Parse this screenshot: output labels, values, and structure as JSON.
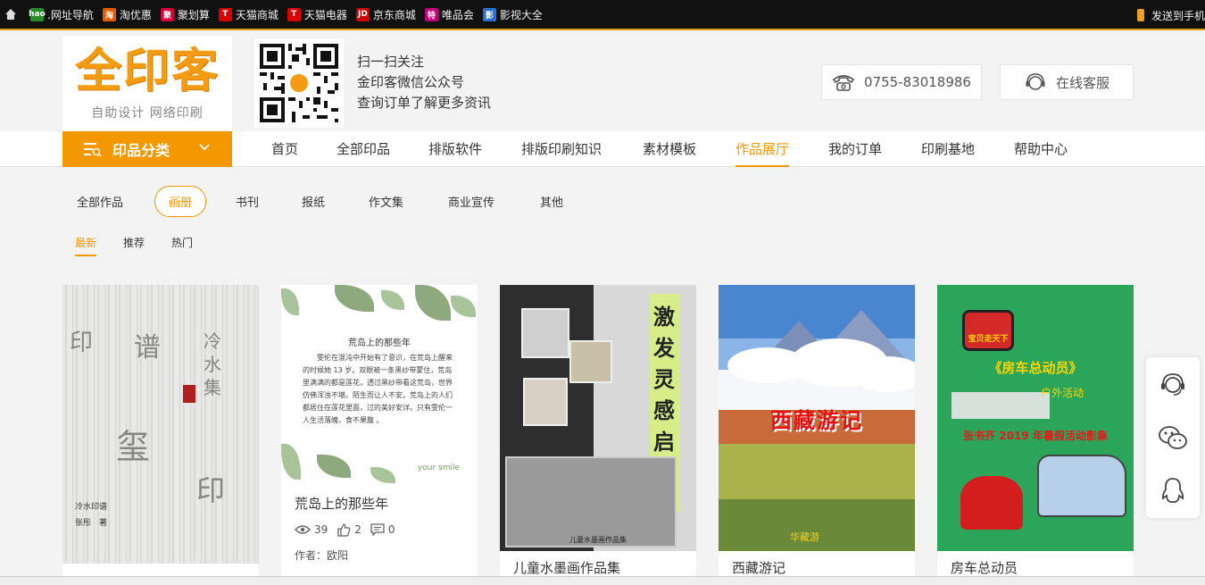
{
  "bookmarks": {
    "items": [
      {
        "icon": "hao",
        "color": "#2b8a2b",
        "label": ".网址导航"
      },
      {
        "icon": "淘",
        "color": "#e85a00",
        "label": "淘优惠"
      },
      {
        "icon": "聚",
        "color": "#d6003a",
        "label": "聚划算"
      },
      {
        "icon": "T",
        "color": "#d80000",
        "label": "天猫商城"
      },
      {
        "icon": "T",
        "color": "#d80000",
        "label": "天猫电器"
      },
      {
        "icon": "JD",
        "color": "#cc0000",
        "label": "京东商城"
      },
      {
        "icon": "特",
        "color": "#c2007a",
        "label": "唯品会"
      },
      {
        "icon": "影",
        "color": "#2b6fd0",
        "label": "影视大全"
      }
    ],
    "send_to_phone": "发送到手机"
  },
  "header": {
    "logo": "全印客",
    "logo_sub": "自助设计  网络印刷",
    "qr_lines": [
      "扫一扫关注",
      "金印客微信公众号",
      "查询订单了解更多资讯"
    ],
    "hotline": "0755-83018986",
    "online_service": "在线客服"
  },
  "nav": {
    "category_label": "印品分类",
    "items": [
      "首页",
      "全部印品",
      "排版软件",
      "排版印刷知识",
      "素材模板",
      "作品展厅",
      "我的订单",
      "印刷基地",
      "帮助中心"
    ],
    "active": "作品展厅"
  },
  "filters": {
    "categories": [
      "全部作品",
      "画册",
      "书刊",
      "报纸",
      "作文集",
      "商业宣传",
      "其他"
    ],
    "active_category": "画册",
    "sorts": [
      "最新",
      "推荐",
      "热门"
    ],
    "active_sort": "最新"
  },
  "cards": [
    {
      "title": "",
      "cover_credit_1": "冷水印谱",
      "cover_credit_2": "张彤　著",
      "cover_chars": [
        "印",
        "谱",
        "玺",
        "印",
        "冷水集"
      ]
    },
    {
      "title": "荒岛上的那些年",
      "cover_title": "荒岛上的那些年",
      "cover_text": "雯伦在混沌中开始有了意识，在荒岛上醒来的时候她 13 岁。双眼被一条黑纱带蒙住，荒岛里满满的都是莲花，透过黑纱带看这荒岛，世界仿佛浑浊不堪。陌生而让人不安。荒岛上的人们都居住在莲花里面，过的美好安详。只有雯伦一人生活落魄，食不果腹 。",
      "cover_footer": "your smile",
      "views": "39",
      "likes": "2",
      "comments": "0",
      "author": "作者：欧阳"
    },
    {
      "title": "儿童水墨画作品集",
      "cover_title": "激发灵感启发天赋",
      "cover_caption": "儿童水墨画作品集"
    },
    {
      "title": "西藏游记",
      "cover_title": "西藏游记",
      "cover_footer": "华藏游"
    },
    {
      "title": "房车总动员",
      "cover_badge": "宝贝走天下",
      "cover_title": "《房车总动员》",
      "cover_sub": "户外活动",
      "cover_red": "张书齐 2019 年暑假活动影集"
    }
  ]
}
